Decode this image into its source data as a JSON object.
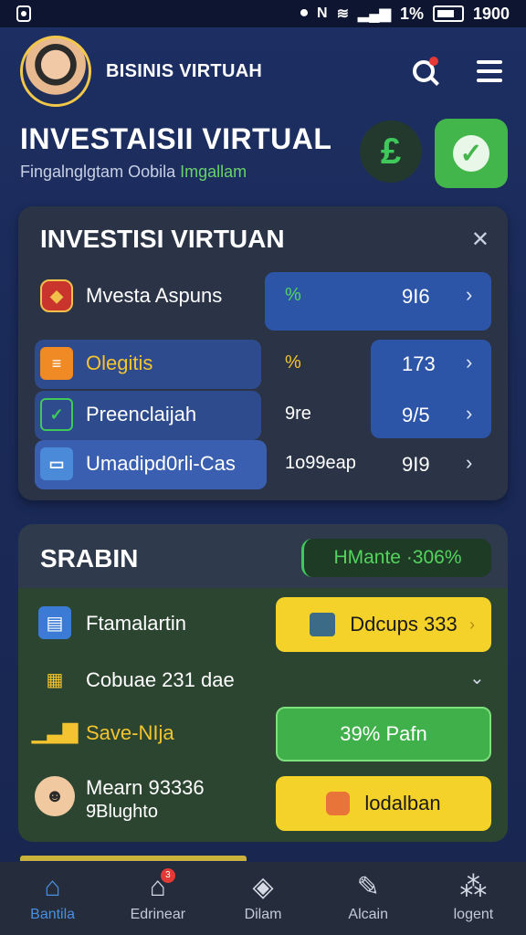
{
  "status_bar": {
    "battery_pct": "1%",
    "time": "1900"
  },
  "header": {
    "app_title": "BISINIS VIRTUAH"
  },
  "hero": {
    "title": "INVESTAISII VIRTUAL",
    "subtitle_main": "Fingalnglgtam Oobila",
    "subtitle_accent": "Imgallam"
  },
  "invest_panel": {
    "title": "INVESTISI VIRTUAN",
    "rows": [
      {
        "label": "Mvesta Aspuns",
        "mid": "% ",
        "value": "9I6"
      },
      {
        "label": "Olegitis",
        "mid": "%",
        "value": "173"
      },
      {
        "label": "Preenclaijah",
        "mid": "9re",
        "value": "9/5"
      },
      {
        "label": "Umadipd0rli-Cas",
        "mid": "1ᴏ99eap",
        "value": "9I9"
      }
    ]
  },
  "savings_panel": {
    "title": "SRABIN",
    "pill": "HMante ·306%",
    "rows": [
      {
        "label": "Ftamalartin",
        "button": "Ddcups 333"
      },
      {
        "label": "Cobuae 231 dae",
        "button": ""
      },
      {
        "label": "Save-NIja",
        "button": "39% Pafn"
      },
      {
        "label": "Mearn 93336",
        "sublabel": "9̈Blughto",
        "button": "lodalban"
      }
    ]
  },
  "bottom_nav": [
    {
      "label": "Bantila",
      "icon": "home-icon",
      "active": true
    },
    {
      "label": "Edrinear",
      "icon": "store-icon",
      "badge": "3"
    },
    {
      "label": "Dilam",
      "icon": "bag-icon"
    },
    {
      "label": "Alcain",
      "icon": "edit-icon"
    },
    {
      "label": "logent",
      "icon": "network-icon"
    }
  ],
  "colors": {
    "accent_green": "#43b64b",
    "accent_yellow": "#f4d22a",
    "accent_blue": "#4a90e2",
    "bg": "#1d2f63"
  }
}
